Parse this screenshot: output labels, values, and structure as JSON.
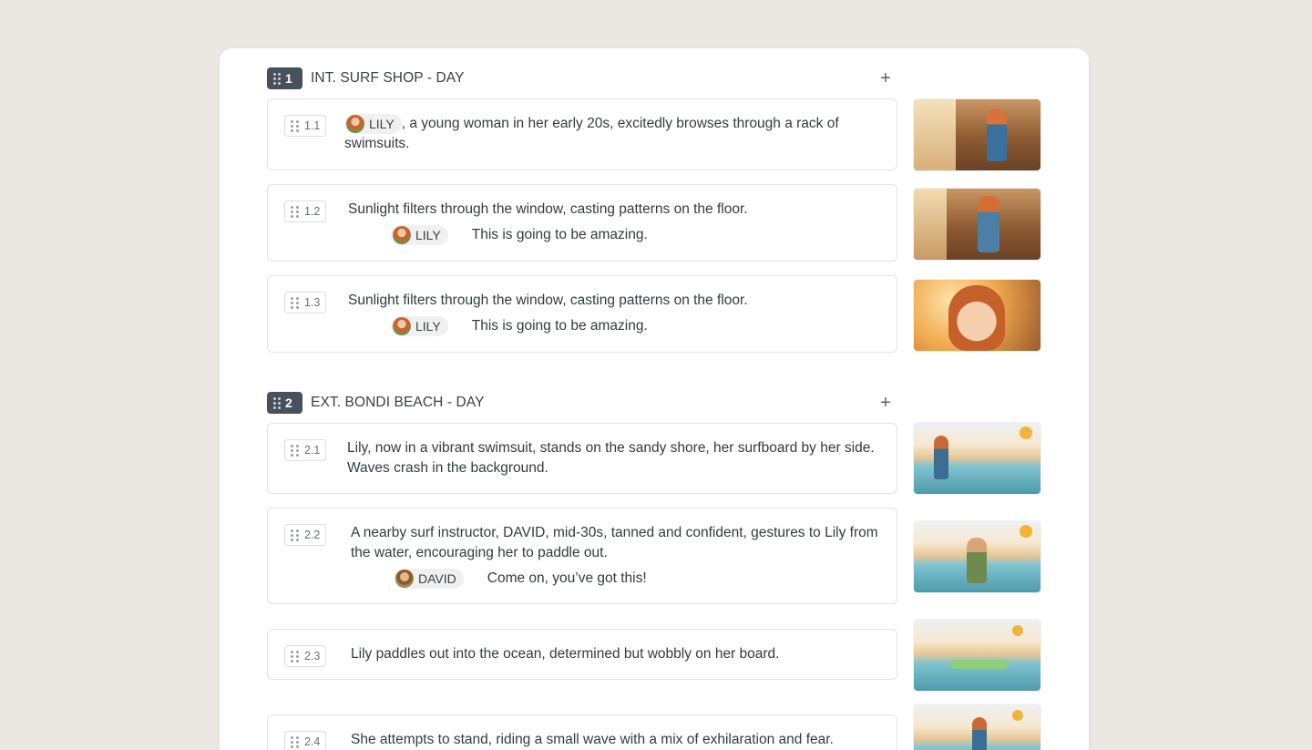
{
  "scenes": [
    {
      "number": "1",
      "title": "INT. SURF SHOP - DAY",
      "add_label": "+",
      "shots": [
        {
          "number": "1.1",
          "character": "LILY",
          "text": ", a young woman in her early 20s, excitedly browses through a rack of swimsuits.",
          "thumbnail": "surf-shop-browsing"
        },
        {
          "number": "1.2",
          "text": "Sunlight filters through the window, casting patterns on the floor.",
          "dialogue": {
            "character": "LILY",
            "line": "This is going to be amazing."
          },
          "thumbnail": "surf-shop-swimsuit"
        },
        {
          "number": "1.3",
          "text": "Sunlight filters through the window, casting patterns on the floor.",
          "dialogue": {
            "character": "LILY",
            "line": "This is going to be amazing."
          },
          "thumbnail": "lily-closeup"
        }
      ]
    },
    {
      "number": "2",
      "title": "EXT. BONDI BEACH - DAY",
      "add_label": "+",
      "shots": [
        {
          "number": "2.1",
          "text": "Lily, now in a vibrant swimsuit, stands on the sandy shore, her surfboard by her side. Waves crash in the background.",
          "thumbnail": "beach-shore"
        },
        {
          "number": "2.2",
          "text": "A nearby surf instructor, DAVID, mid-30s, tanned and confident, gestures to Lily from the water, encouraging her to paddle out.",
          "dialogue": {
            "character": "DAVID",
            "line": "Come on, you’ve got this!"
          },
          "thumbnail": "david-in-water"
        },
        {
          "number": "2.3",
          "text": "Lily paddles out into the ocean, determined but wobbly on her board.",
          "thumbnail": "lily-paddling"
        },
        {
          "number": "2.4",
          "text": "She attempts to stand, riding a small wave with a mix of exhilaration and fear.",
          "thumbnail": "lily-riding-wave"
        }
      ]
    }
  ],
  "colors": {
    "page_bg": "#ebe7e3",
    "panel_bg": "#ffffff",
    "scene_badge": "#48505b"
  }
}
